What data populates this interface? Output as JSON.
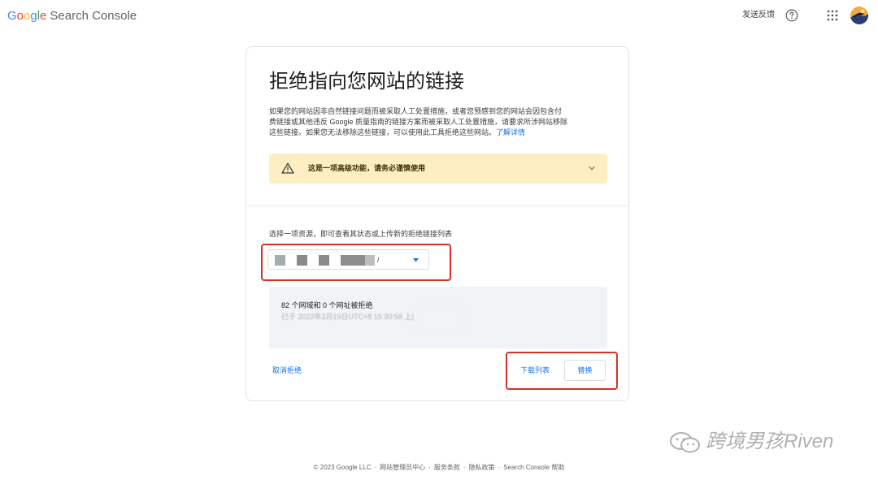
{
  "header": {
    "logo_google": "Google",
    "logo_product": "Search Console",
    "feedback_label": "发送反馈"
  },
  "colors": {
    "google_blue": "#4285F4",
    "google_red": "#EA4335",
    "google_yellow": "#FBBC05",
    "google_green": "#34A853",
    "link": "#1a73e8",
    "warning_bg": "#fdefc3",
    "highlight_red": "#d93025"
  },
  "icons": {
    "help": "help-circle-icon",
    "apps": "apps-grid-icon",
    "warning": "warning-triangle-icon",
    "chevron": "chevron-down-icon",
    "dropdown": "dropdown-arrow-icon"
  },
  "card": {
    "title": "拒绝指向您网站的链接",
    "description_line1": "如果您的网站因非自然链接问题而被采取人工处置措施，或者您预感到您的网站会因包含付",
    "description_line2": "费链接或其他违反 Google 质量指南的链接方案而被采取人工处置措施，请要求所涉网站移除",
    "description_line3": "这些链接。如果您无法移除这些链接，可以使用此工具拒绝这些网站。",
    "learn_more": "了解详情",
    "warning_text": "这是一项高级功能，请务必谨慎使用",
    "select_label": "选择一项资源，即可查看其状态或上传新的拒绝链接列表",
    "resource_suffix": "/",
    "status_count": "82 个网域和 0 个网址被拒绝",
    "status_date": "已于 2022年2月19日UTC+8 15:30:58 上(",
    "cancel_label": "取消拒绝",
    "download_label": "下载列表",
    "replace_label": "替换"
  },
  "footer": {
    "copyright": "© 2023 Google LLC",
    "webmaster": "网站管理员中心",
    "terms": "服务条款",
    "privacy": "隐私政策",
    "help": "Search Console 帮助",
    "separator": "·"
  },
  "watermark": {
    "text": "跨境男孩Riven"
  }
}
